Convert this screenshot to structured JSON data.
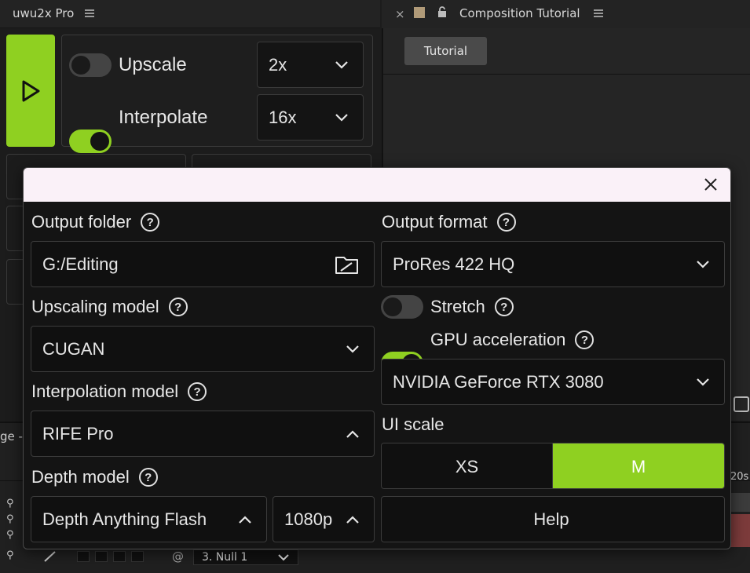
{
  "panel": {
    "title": "uwu2x Pro",
    "upscale": {
      "label": "Upscale",
      "enabled": false,
      "factor": "2x"
    },
    "interpolate": {
      "label": "Interpolate",
      "enabled": true,
      "factor": "16x"
    }
  },
  "composition": {
    "title": "Composition Tutorial",
    "close": "×",
    "tab": "Tutorial"
  },
  "timeline": {
    "panel_label": "ge -",
    "ruler_label": "20s",
    "layer_name": "3. Null 1"
  },
  "modal": {
    "output_folder": {
      "label": "Output folder",
      "value": "G:/Editing"
    },
    "upscaling_model": {
      "label": "Upscaling model",
      "value": "CUGAN"
    },
    "interpolation_model": {
      "label": "Interpolation model",
      "value": "RIFE Pro"
    },
    "depth_model": {
      "label": "Depth model",
      "value": "Depth Anything Flash",
      "resolution": "1080p"
    },
    "output_format": {
      "label": "Output format",
      "value": "ProRes 422 HQ"
    },
    "stretch": {
      "label": "Stretch",
      "enabled": false
    },
    "gpu_acceleration": {
      "label": "GPU acceleration",
      "enabled": true
    },
    "gpu_device": {
      "value": "NVIDIA GeForce RTX 3080"
    },
    "ui_scale": {
      "label": "UI scale",
      "options": [
        "XS",
        "M"
      ],
      "selected": "M"
    },
    "help_label": "Help",
    "help_glyph": "?"
  },
  "colors": {
    "accent": "#8fd021",
    "modal_bg": "#141414",
    "titlebar": "#faf1f8"
  }
}
